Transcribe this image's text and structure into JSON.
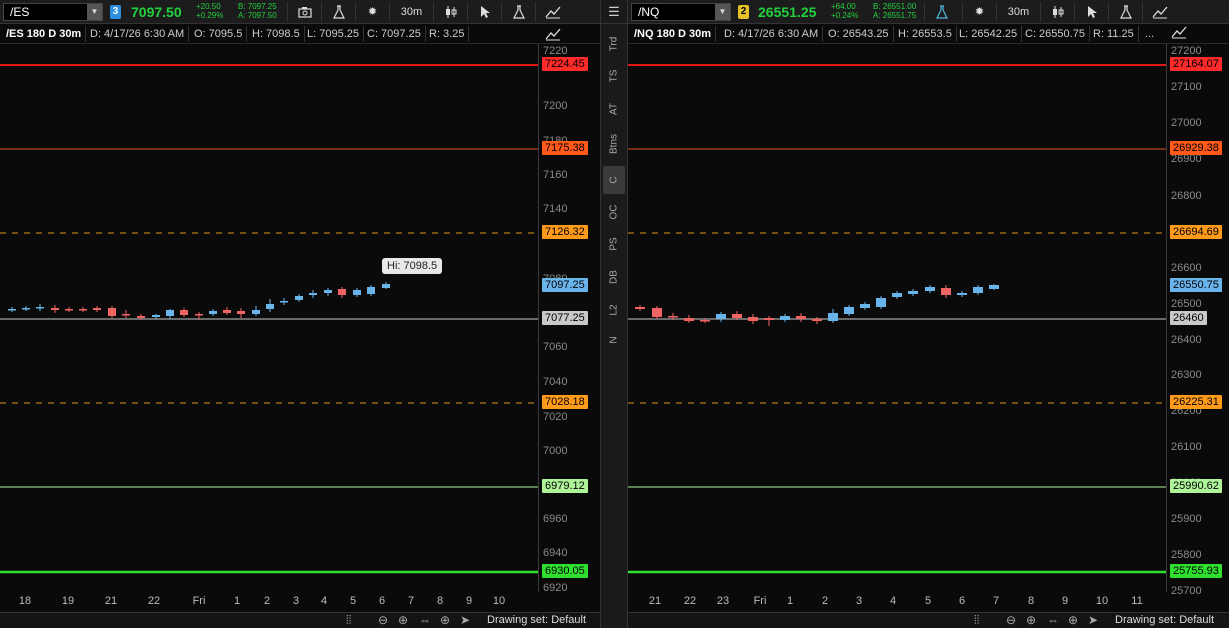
{
  "es": {
    "toolbar": {
      "symbol": "/ES",
      "link_badge": "3",
      "last": "7097.50",
      "net_change": "+20.50",
      "pct_change": "+0.29%",
      "bid": "B: 7097.25",
      "ask": "A: 7097.50",
      "timeframe": "30m"
    },
    "infobar": {
      "title": "/ES 180 D 30m",
      "date": "D: 4/17/26 6:30 AM",
      "open": "O: 7095.5",
      "high": "H: 7098.5",
      "low": "L: 7095.25",
      "close": "C: 7097.25",
      "range": "R: 3.25"
    },
    "price_ticks": [
      "7220",
      "7200",
      "7180",
      "7160",
      "7140",
      "7080",
      "7060",
      "7040",
      "7020",
      "7000",
      "6960",
      "6940",
      "6920"
    ],
    "price_tags": [
      {
        "text": "7224.45",
        "color": "#ff2a2a"
      },
      {
        "text": "7175.38",
        "color": "#ff5a1a"
      },
      {
        "text": "7126.32",
        "color": "#ff9a1a"
      },
      {
        "text": "7097.25",
        "color": "#6ab4ec"
      },
      {
        "text": "7077.25",
        "color": "#c9c9c9"
      },
      {
        "text": "7028.18",
        "color": "#ff9a1a"
      },
      {
        "text": "6979.12",
        "color": "#aef59a"
      },
      {
        "text": "6930.05",
        "color": "#2fe02f"
      }
    ],
    "x_labels": [
      "18",
      "19",
      "21",
      "22",
      "Fri",
      "1",
      "2",
      "3",
      "4",
      "5",
      "6",
      "7",
      "8",
      "9",
      "10"
    ],
    "tooltip": "Hi: 7098.5",
    "status": "Drawing set: Default"
  },
  "nq": {
    "toolbar": {
      "symbol": "/NQ",
      "link_badge": "2",
      "last": "26551.25",
      "net_change": "+64.00",
      "pct_change": "+0.24%",
      "bid": "B: 26551.00",
      "ask": "A: 26551.75",
      "timeframe": "30m"
    },
    "infobar": {
      "title": "/NQ 180 D 30m",
      "date": "D: 4/17/26 6:30 AM",
      "open": "O: 26543.25",
      "high": "H: 26553.5",
      "low": "L: 26542.25",
      "close": "C: 26550.75",
      "range": "R: 11.25",
      "more": "..."
    },
    "price_ticks": [
      "27200",
      "27100",
      "27000",
      "26900",
      "26800",
      "26700",
      "26600",
      "26500",
      "26400",
      "26300",
      "26200",
      "26100",
      "26000",
      "25900",
      "25800",
      "25700"
    ],
    "price_tags": [
      {
        "text": "27164.07",
        "color": "#ff2a2a"
      },
      {
        "text": "26929.38",
        "color": "#ff5a1a"
      },
      {
        "text": "26694.69",
        "color": "#ff9a1a"
      },
      {
        "text": "26550.75",
        "color": "#6ab4ec"
      },
      {
        "text": "26460",
        "color": "#c9c9c9"
      },
      {
        "text": "26225.31",
        "color": "#ff9a1a"
      },
      {
        "text": "25990.62",
        "color": "#aef59a"
      },
      {
        "text": "25755.93",
        "color": "#2fe02f"
      }
    ],
    "x_labels": [
      "21",
      "22",
      "23",
      "Fri",
      "1",
      "2",
      "3",
      "4",
      "5",
      "6",
      "7",
      "8",
      "9",
      "10",
      "11"
    ],
    "status": "Drawing set: Default"
  },
  "side_rail": {
    "tabs": [
      "Trd",
      "TS",
      "AT",
      "Btns",
      "C",
      "OC",
      "PS",
      "DB",
      "L2",
      "N"
    ],
    "active": "C"
  },
  "colors": {
    "up_candle": "#6ab4ec",
    "down_candle": "#f06464",
    "accent_green": "#22d03e"
  },
  "icons": [
    "dropdown-icon",
    "camera-icon",
    "flask-icon",
    "gear-icon",
    "candles-icon",
    "cursor-icon",
    "drawing-icon",
    "menu-icon",
    "zoom-out-icon",
    "zoom-in-icon",
    "pan-icon",
    "crosshair-icon"
  ]
}
